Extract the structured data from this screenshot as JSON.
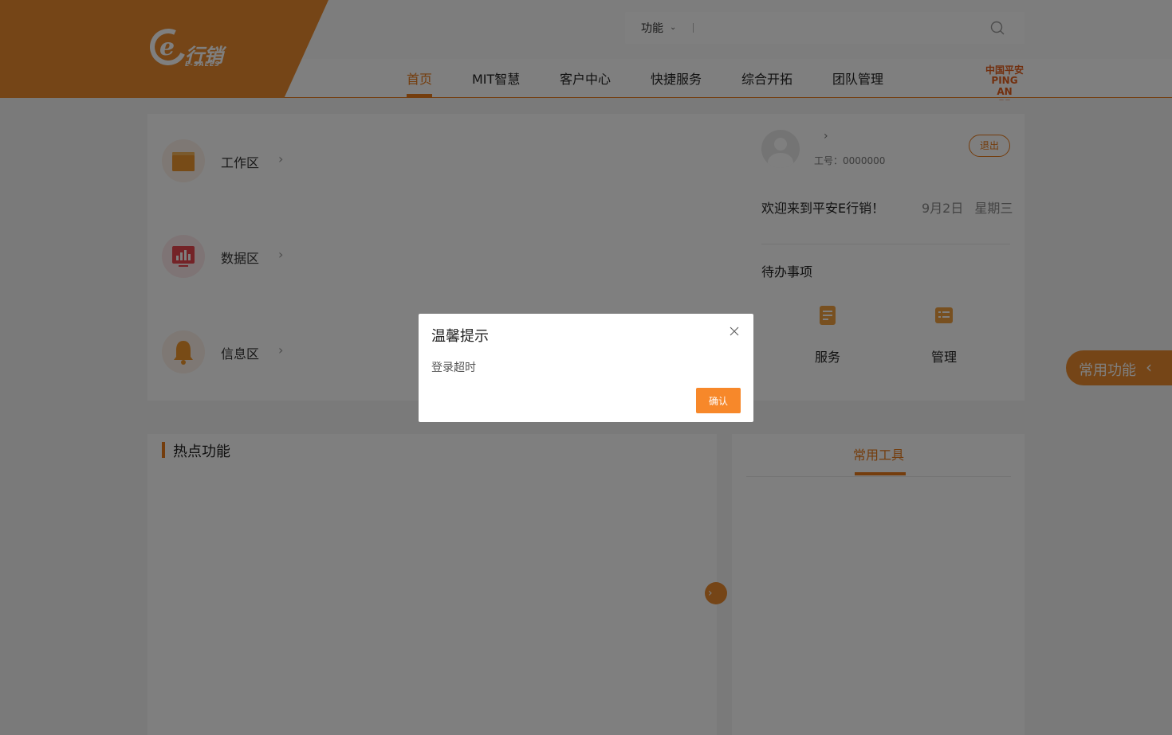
{
  "header": {
    "logo_cn": "行销",
    "logo_en": "E-SALES",
    "search": {
      "selected": "功能",
      "placeholder": ""
    },
    "nav": [
      {
        "label": "首页",
        "active": true
      },
      {
        "label": "MIT智慧"
      },
      {
        "label": "客户中心"
      },
      {
        "label": "快捷服务"
      },
      {
        "label": "综合开拓"
      },
      {
        "label": "团队管理"
      }
    ],
    "pingan": {
      "cn": "中国平安",
      "en": "PING AN"
    }
  },
  "zones": [
    {
      "label": "工作区",
      "icon": "folder-icon"
    },
    {
      "label": "数据区",
      "icon": "data-chart-icon"
    },
    {
      "label": "信息区",
      "icon": "bell-icon"
    }
  ],
  "user": {
    "employee_no": "工号：0000000",
    "logout_label": "退出",
    "welcome": "欢迎来到平安E行销！",
    "date": "9月2日",
    "weekday": "星期三",
    "todo_title": "待办事项",
    "todos": [
      {
        "label": "服务",
        "icon": "service-doc-icon"
      },
      {
        "label": "管理",
        "icon": "manage-list-icon"
      }
    ]
  },
  "hot": {
    "title": "热点功能"
  },
  "tools": {
    "title": "常用工具"
  },
  "float_tab": {
    "label": "常用功能"
  },
  "dialog": {
    "title": "温馨提示",
    "message": "登录超时",
    "confirm_label": "确认"
  },
  "colors": {
    "accent": "#e97a1b",
    "brand_wedge": "#ea8a2e",
    "pingan": "#e45f1c"
  }
}
